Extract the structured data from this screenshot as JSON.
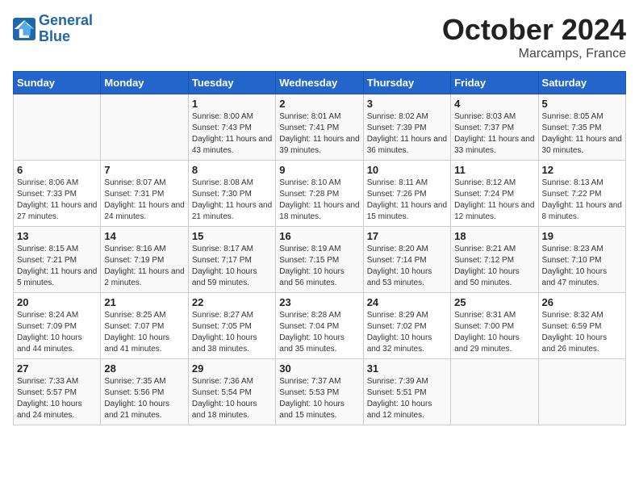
{
  "header": {
    "logo_line1": "General",
    "logo_line2": "Blue",
    "month": "October 2024",
    "location": "Marcamps, France"
  },
  "weekdays": [
    "Sunday",
    "Monday",
    "Tuesday",
    "Wednesday",
    "Thursday",
    "Friday",
    "Saturday"
  ],
  "weeks": [
    [
      {
        "day": "",
        "info": ""
      },
      {
        "day": "",
        "info": ""
      },
      {
        "day": "1",
        "info": "Sunrise: 8:00 AM\nSunset: 7:43 PM\nDaylight: 11 hours and 43 minutes."
      },
      {
        "day": "2",
        "info": "Sunrise: 8:01 AM\nSunset: 7:41 PM\nDaylight: 11 hours and 39 minutes."
      },
      {
        "day": "3",
        "info": "Sunrise: 8:02 AM\nSunset: 7:39 PM\nDaylight: 11 hours and 36 minutes."
      },
      {
        "day": "4",
        "info": "Sunrise: 8:03 AM\nSunset: 7:37 PM\nDaylight: 11 hours and 33 minutes."
      },
      {
        "day": "5",
        "info": "Sunrise: 8:05 AM\nSunset: 7:35 PM\nDaylight: 11 hours and 30 minutes."
      }
    ],
    [
      {
        "day": "6",
        "info": "Sunrise: 8:06 AM\nSunset: 7:33 PM\nDaylight: 11 hours and 27 minutes."
      },
      {
        "day": "7",
        "info": "Sunrise: 8:07 AM\nSunset: 7:31 PM\nDaylight: 11 hours and 24 minutes."
      },
      {
        "day": "8",
        "info": "Sunrise: 8:08 AM\nSunset: 7:30 PM\nDaylight: 11 hours and 21 minutes."
      },
      {
        "day": "9",
        "info": "Sunrise: 8:10 AM\nSunset: 7:28 PM\nDaylight: 11 hours and 18 minutes."
      },
      {
        "day": "10",
        "info": "Sunrise: 8:11 AM\nSunset: 7:26 PM\nDaylight: 11 hours and 15 minutes."
      },
      {
        "day": "11",
        "info": "Sunrise: 8:12 AM\nSunset: 7:24 PM\nDaylight: 11 hours and 12 minutes."
      },
      {
        "day": "12",
        "info": "Sunrise: 8:13 AM\nSunset: 7:22 PM\nDaylight: 11 hours and 8 minutes."
      }
    ],
    [
      {
        "day": "13",
        "info": "Sunrise: 8:15 AM\nSunset: 7:21 PM\nDaylight: 11 hours and 5 minutes."
      },
      {
        "day": "14",
        "info": "Sunrise: 8:16 AM\nSunset: 7:19 PM\nDaylight: 11 hours and 2 minutes."
      },
      {
        "day": "15",
        "info": "Sunrise: 8:17 AM\nSunset: 7:17 PM\nDaylight: 10 hours and 59 minutes."
      },
      {
        "day": "16",
        "info": "Sunrise: 8:19 AM\nSunset: 7:15 PM\nDaylight: 10 hours and 56 minutes."
      },
      {
        "day": "17",
        "info": "Sunrise: 8:20 AM\nSunset: 7:14 PM\nDaylight: 10 hours and 53 minutes."
      },
      {
        "day": "18",
        "info": "Sunrise: 8:21 AM\nSunset: 7:12 PM\nDaylight: 10 hours and 50 minutes."
      },
      {
        "day": "19",
        "info": "Sunrise: 8:23 AM\nSunset: 7:10 PM\nDaylight: 10 hours and 47 minutes."
      }
    ],
    [
      {
        "day": "20",
        "info": "Sunrise: 8:24 AM\nSunset: 7:09 PM\nDaylight: 10 hours and 44 minutes."
      },
      {
        "day": "21",
        "info": "Sunrise: 8:25 AM\nSunset: 7:07 PM\nDaylight: 10 hours and 41 minutes."
      },
      {
        "day": "22",
        "info": "Sunrise: 8:27 AM\nSunset: 7:05 PM\nDaylight: 10 hours and 38 minutes."
      },
      {
        "day": "23",
        "info": "Sunrise: 8:28 AM\nSunset: 7:04 PM\nDaylight: 10 hours and 35 minutes."
      },
      {
        "day": "24",
        "info": "Sunrise: 8:29 AM\nSunset: 7:02 PM\nDaylight: 10 hours and 32 minutes."
      },
      {
        "day": "25",
        "info": "Sunrise: 8:31 AM\nSunset: 7:00 PM\nDaylight: 10 hours and 29 minutes."
      },
      {
        "day": "26",
        "info": "Sunrise: 8:32 AM\nSunset: 6:59 PM\nDaylight: 10 hours and 26 minutes."
      }
    ],
    [
      {
        "day": "27",
        "info": "Sunrise: 7:33 AM\nSunset: 5:57 PM\nDaylight: 10 hours and 24 minutes."
      },
      {
        "day": "28",
        "info": "Sunrise: 7:35 AM\nSunset: 5:56 PM\nDaylight: 10 hours and 21 minutes."
      },
      {
        "day": "29",
        "info": "Sunrise: 7:36 AM\nSunset: 5:54 PM\nDaylight: 10 hours and 18 minutes."
      },
      {
        "day": "30",
        "info": "Sunrise: 7:37 AM\nSunset: 5:53 PM\nDaylight: 10 hours and 15 minutes."
      },
      {
        "day": "31",
        "info": "Sunrise: 7:39 AM\nSunset: 5:51 PM\nDaylight: 10 hours and 12 minutes."
      },
      {
        "day": "",
        "info": ""
      },
      {
        "day": "",
        "info": ""
      }
    ]
  ]
}
